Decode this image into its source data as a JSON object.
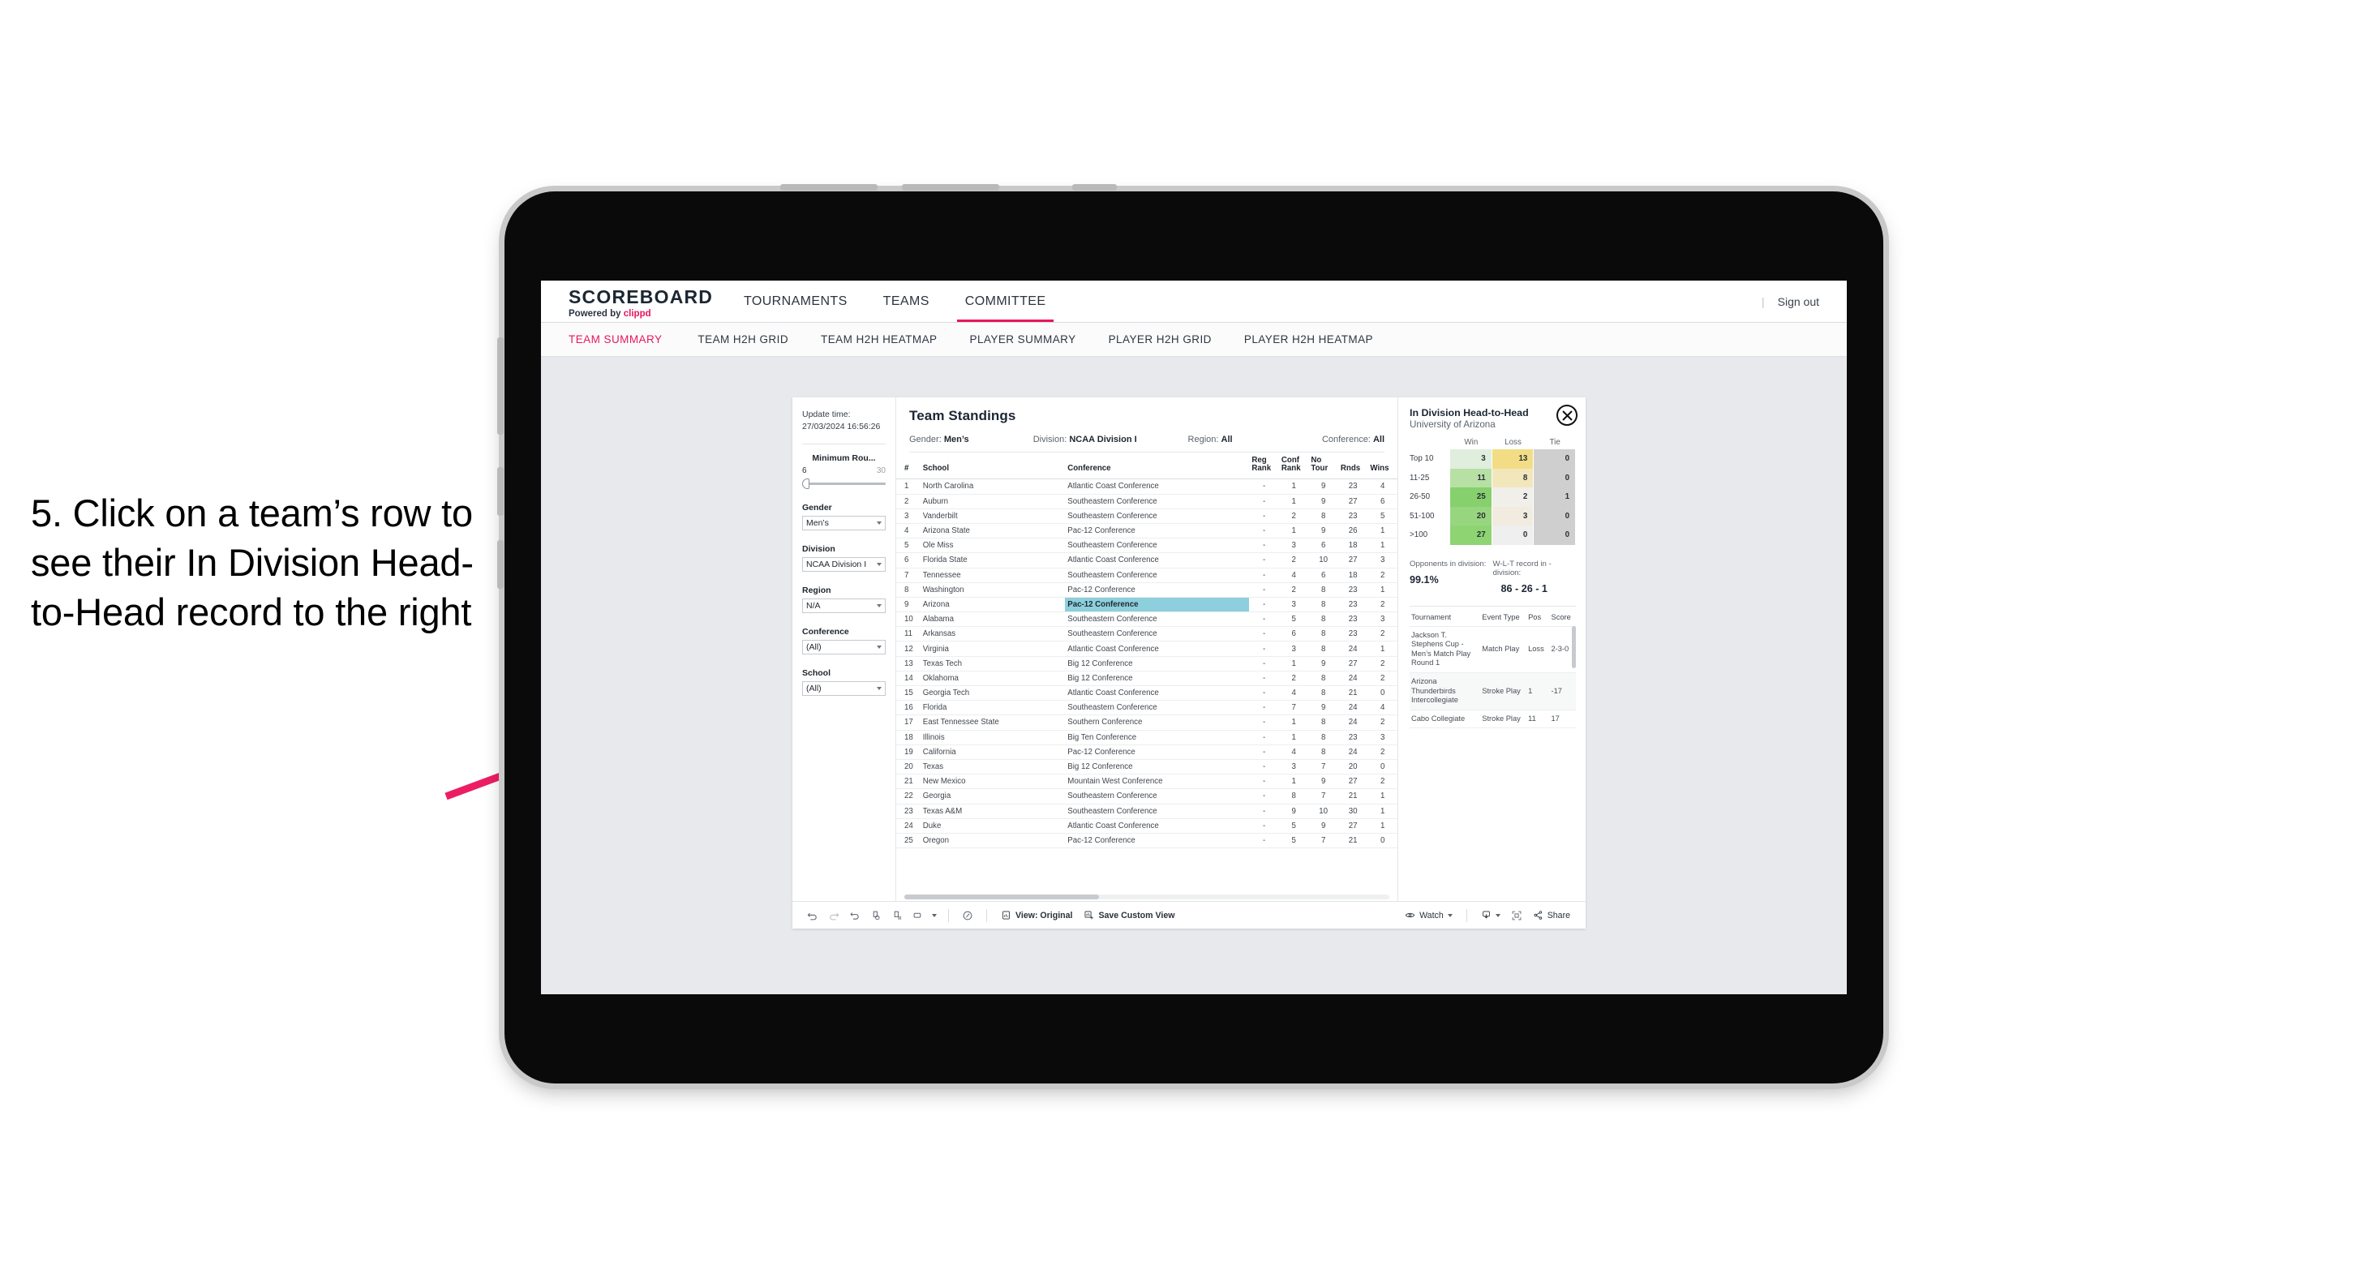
{
  "annotation": {
    "text": "5. Click on a team’s row to see their In Division Head-to-Head record to the right",
    "arrow_color": "#ec1e63"
  },
  "brand": {
    "title": "SCOREBOARD",
    "powered_prefix": "Powered by",
    "powered_name": "clippd",
    "accent": "#e8175d"
  },
  "topnav": {
    "items": [
      {
        "label": "TOURNAMENTS",
        "active": false
      },
      {
        "label": "TEAMS",
        "active": false
      },
      {
        "label": "COMMITTEE",
        "active": true
      }
    ],
    "divider": "|",
    "sign_out": "Sign out"
  },
  "subnav": {
    "items": [
      {
        "label": "TEAM SUMMARY",
        "active": true
      },
      {
        "label": "TEAM H2H GRID",
        "active": false
      },
      {
        "label": "TEAM H2H HEATMAP",
        "active": false
      },
      {
        "label": "PLAYER SUMMARY",
        "active": false
      },
      {
        "label": "PLAYER H2H GRID",
        "active": false
      },
      {
        "label": "PLAYER H2H HEATMAP",
        "active": false
      }
    ]
  },
  "filters": {
    "update_label": "Update time:",
    "update_value": "27/03/2024 16:56:26",
    "min_rounds": {
      "label": "Minimum Rou...",
      "min": "6",
      "max": "30"
    },
    "gender": {
      "label": "Gender",
      "value": "Men’s"
    },
    "division": {
      "label": "Division",
      "value": "NCAA Division I"
    },
    "region": {
      "label": "Region",
      "value": "N/A"
    },
    "conference": {
      "label": "Conference",
      "value": "(All)"
    },
    "school": {
      "label": "School",
      "value": "(All)"
    }
  },
  "standings": {
    "title": "Team Standings",
    "summary": [
      {
        "key": "Gender:",
        "value": "Men’s"
      },
      {
        "key": "Division:",
        "value": "NCAA Division I"
      },
      {
        "key": "Region:",
        "value": "All"
      },
      {
        "key": "Conference:",
        "value": "All"
      }
    ],
    "columns": [
      "#",
      "School",
      "Conference",
      "Reg Rank",
      "Conf Rank",
      "No Tour",
      "Rnds",
      "Wins"
    ],
    "selected_rank": 9,
    "rows": [
      {
        "rank": "1",
        "school": "North Carolina",
        "conference": "Atlantic Coast Conference",
        "reg_rank": "-",
        "conf_rank": "1",
        "no_tour": "9",
        "rnds": "23",
        "wins": "4"
      },
      {
        "rank": "2",
        "school": "Auburn",
        "conference": "Southeastern Conference",
        "reg_rank": "-",
        "conf_rank": "1",
        "no_tour": "9",
        "rnds": "27",
        "wins": "6"
      },
      {
        "rank": "3",
        "school": "Vanderbilt",
        "conference": "Southeastern Conference",
        "reg_rank": "-",
        "conf_rank": "2",
        "no_tour": "8",
        "rnds": "23",
        "wins": "5"
      },
      {
        "rank": "4",
        "school": "Arizona State",
        "conference": "Pac-12 Conference",
        "reg_rank": "-",
        "conf_rank": "1",
        "no_tour": "9",
        "rnds": "26",
        "wins": "1"
      },
      {
        "rank": "5",
        "school": "Ole Miss",
        "conference": "Southeastern Conference",
        "reg_rank": "-",
        "conf_rank": "3",
        "no_tour": "6",
        "rnds": "18",
        "wins": "1"
      },
      {
        "rank": "6",
        "school": "Florida State",
        "conference": "Atlantic Coast Conference",
        "reg_rank": "-",
        "conf_rank": "2",
        "no_tour": "10",
        "rnds": "27",
        "wins": "3"
      },
      {
        "rank": "7",
        "school": "Tennessee",
        "conference": "Southeastern Conference",
        "reg_rank": "-",
        "conf_rank": "4",
        "no_tour": "6",
        "rnds": "18",
        "wins": "2"
      },
      {
        "rank": "8",
        "school": "Washington",
        "conference": "Pac-12 Conference",
        "reg_rank": "-",
        "conf_rank": "2",
        "no_tour": "8",
        "rnds": "23",
        "wins": "1"
      },
      {
        "rank": "9",
        "school": "Arizona",
        "conference": "Pac-12 Conference",
        "reg_rank": "-",
        "conf_rank": "3",
        "no_tour": "8",
        "rnds": "23",
        "wins": "2"
      },
      {
        "rank": "10",
        "school": "Alabama",
        "conference": "Southeastern Conference",
        "reg_rank": "-",
        "conf_rank": "5",
        "no_tour": "8",
        "rnds": "23",
        "wins": "3"
      },
      {
        "rank": "11",
        "school": "Arkansas",
        "conference": "Southeastern Conference",
        "reg_rank": "-",
        "conf_rank": "6",
        "no_tour": "8",
        "rnds": "23",
        "wins": "2"
      },
      {
        "rank": "12",
        "school": "Virginia",
        "conference": "Atlantic Coast Conference",
        "reg_rank": "-",
        "conf_rank": "3",
        "no_tour": "8",
        "rnds": "24",
        "wins": "1"
      },
      {
        "rank": "13",
        "school": "Texas Tech",
        "conference": "Big 12 Conference",
        "reg_rank": "-",
        "conf_rank": "1",
        "no_tour": "9",
        "rnds": "27",
        "wins": "2"
      },
      {
        "rank": "14",
        "school": "Oklahoma",
        "conference": "Big 12 Conference",
        "reg_rank": "-",
        "conf_rank": "2",
        "no_tour": "8",
        "rnds": "24",
        "wins": "2"
      },
      {
        "rank": "15",
        "school": "Georgia Tech",
        "conference": "Atlantic Coast Conference",
        "reg_rank": "-",
        "conf_rank": "4",
        "no_tour": "8",
        "rnds": "21",
        "wins": "0"
      },
      {
        "rank": "16",
        "school": "Florida",
        "conference": "Southeastern Conference",
        "reg_rank": "-",
        "conf_rank": "7",
        "no_tour": "9",
        "rnds": "24",
        "wins": "4"
      },
      {
        "rank": "17",
        "school": "East Tennessee State",
        "conference": "Southern Conference",
        "reg_rank": "-",
        "conf_rank": "1",
        "no_tour": "8",
        "rnds": "24",
        "wins": "2"
      },
      {
        "rank": "18",
        "school": "Illinois",
        "conference": "Big Ten Conference",
        "reg_rank": "-",
        "conf_rank": "1",
        "no_tour": "8",
        "rnds": "23",
        "wins": "3"
      },
      {
        "rank": "19",
        "school": "California",
        "conference": "Pac-12 Conference",
        "reg_rank": "-",
        "conf_rank": "4",
        "no_tour": "8",
        "rnds": "24",
        "wins": "2"
      },
      {
        "rank": "20",
        "school": "Texas",
        "conference": "Big 12 Conference",
        "reg_rank": "-",
        "conf_rank": "3",
        "no_tour": "7",
        "rnds": "20",
        "wins": "0"
      },
      {
        "rank": "21",
        "school": "New Mexico",
        "conference": "Mountain West Conference",
        "reg_rank": "-",
        "conf_rank": "1",
        "no_tour": "9",
        "rnds": "27",
        "wins": "2"
      },
      {
        "rank": "22",
        "school": "Georgia",
        "conference": "Southeastern Conference",
        "reg_rank": "-",
        "conf_rank": "8",
        "no_tour": "7",
        "rnds": "21",
        "wins": "1"
      },
      {
        "rank": "23",
        "school": "Texas A&M",
        "conference": "Southeastern Conference",
        "reg_rank": "-",
        "conf_rank": "9",
        "no_tour": "10",
        "rnds": "30",
        "wins": "1"
      },
      {
        "rank": "24",
        "school": "Duke",
        "conference": "Atlantic Coast Conference",
        "reg_rank": "-",
        "conf_rank": "5",
        "no_tour": "9",
        "rnds": "27",
        "wins": "1"
      },
      {
        "rank": "25",
        "school": "Oregon",
        "conference": "Pac-12 Conference",
        "reg_rank": "-",
        "conf_rank": "5",
        "no_tour": "7",
        "rnds": "21",
        "wins": "0"
      }
    ]
  },
  "h2h": {
    "title": "In Division Head-to-Head",
    "subtitle": "University of Arizona",
    "close_icon": "close-icon",
    "opponents_label": "Opponents in division:",
    "opponents_value": "99.1%",
    "record_label": "W-L-T record in -division:",
    "record_value": "86 - 26 - 1",
    "tournament_columns": [
      "Tournament",
      "Event Type",
      "Pos",
      "Score"
    ],
    "tournaments": [
      {
        "name": "Jackson T. Stephens Cup - Men’s Match Play Round 1",
        "event_type": "Match Play",
        "pos": "Loss",
        "score": "2-3-0"
      },
      {
        "name": "Arizona Thunderbirds Intercollegiate",
        "event_type": "Stroke Play",
        "pos": "1",
        "score": "-17"
      },
      {
        "name": "Cabo Collegiate",
        "event_type": "Stroke Play",
        "pos": "11",
        "score": "17"
      }
    ]
  },
  "chart_data": {
    "type": "heatmap",
    "title": "In Division Head-to-Head",
    "subtitle": "University of Arizona",
    "columns": [
      "Win",
      "Loss",
      "Tie"
    ],
    "categories": [
      "Top 10",
      "11-25",
      "26-50",
      "51-100",
      ">100"
    ],
    "rows": [
      {
        "label": "Top 10",
        "win": 3,
        "loss": 13,
        "tie": 0,
        "win_color": "#dfeedd",
        "loss_color": "#f2dd86",
        "tie_color": "#cfcfcf"
      },
      {
        "label": "11-25",
        "win": 11,
        "loss": 8,
        "tie": 0,
        "win_color": "#b7e0a5",
        "loss_color": "#f2e7bb",
        "tie_color": "#cfcfcf"
      },
      {
        "label": "26-50",
        "win": 25,
        "loss": 2,
        "tie": 1,
        "win_color": "#86d06e",
        "loss_color": "#f0efea",
        "tie_color": "#cfcfcf"
      },
      {
        "label": "51-100",
        "win": 20,
        "loss": 3,
        "tie": 0,
        "win_color": "#97d67f",
        "loss_color": "#f2ece0",
        "tie_color": "#cfcfcf"
      },
      {
        "label": ">100",
        "win": 27,
        "loss": 0,
        "tie": 0,
        "win_color": "#8ed473",
        "loss_color": "#efefef",
        "tie_color": "#cfcfcf"
      }
    ],
    "xlabel": "",
    "ylabel": "Opponent rank band",
    "legend": "none"
  },
  "toolbar": {
    "icons": [
      "undo-icon",
      "redo-icon",
      "revert-icon",
      "refresh-data-icon",
      "pause-updates-icon",
      "device-layout-icon"
    ],
    "view_label": "View: Original",
    "save_label": "Save Custom View",
    "watch_label": "Watch",
    "share_label": "Share",
    "download_icon": "download-icon",
    "fullscreen_icon": "fullscreen-icon"
  }
}
